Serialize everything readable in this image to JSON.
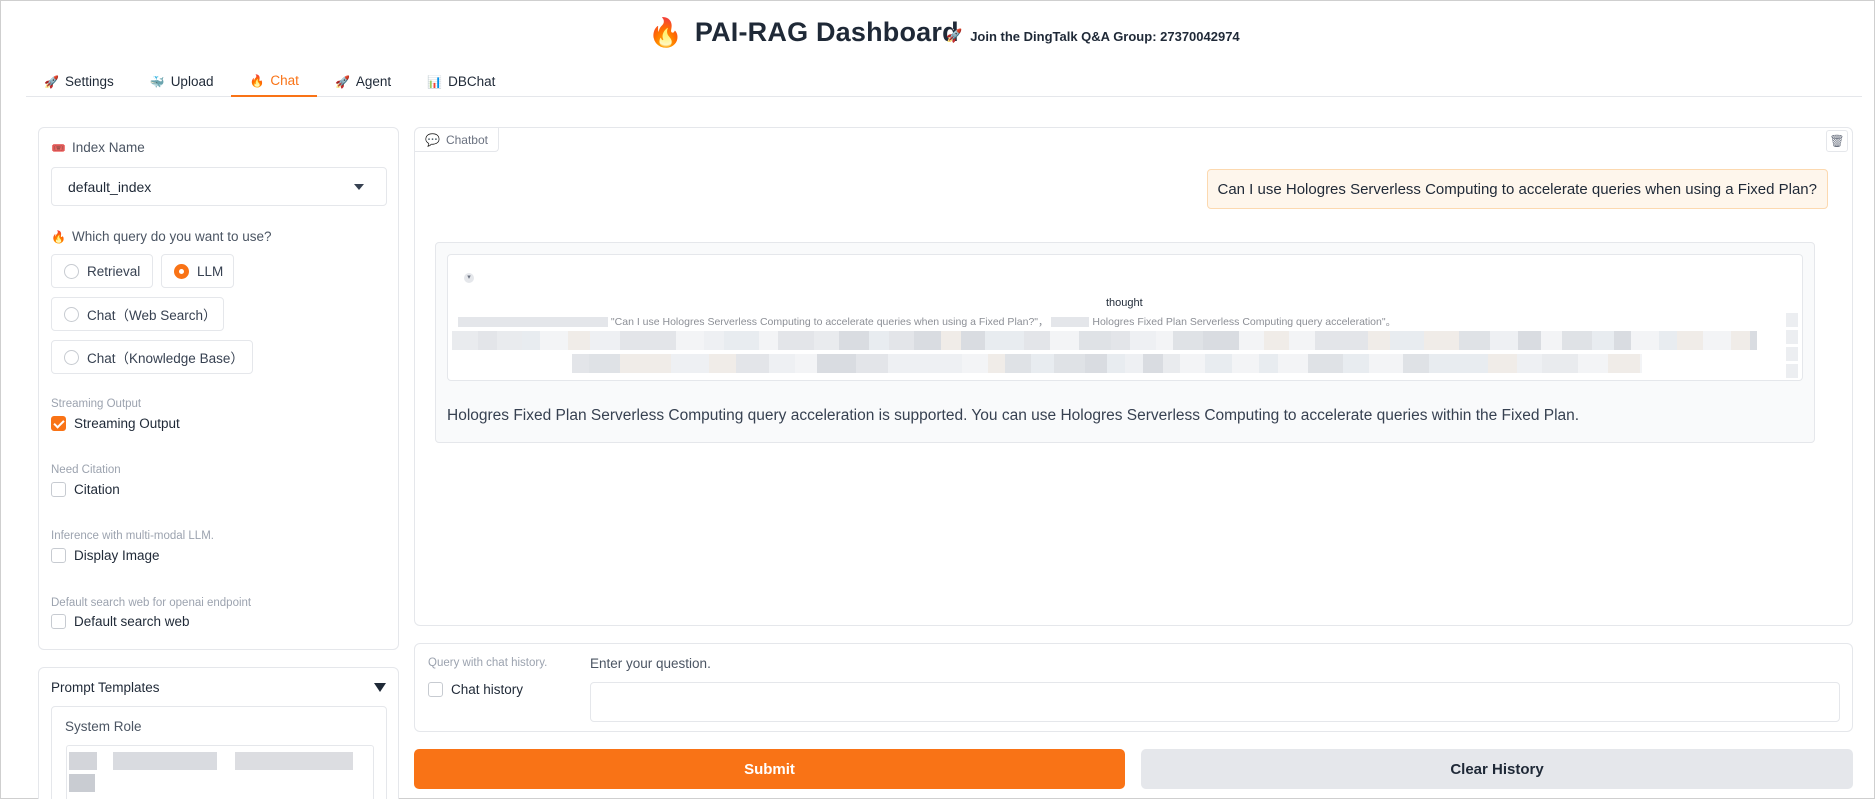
{
  "header": {
    "title": "PAI-RAG Dashboard",
    "title_icon": "flame-icon",
    "group_icon": "rocket-icon",
    "group_text": "Join the DingTalk Q&A Group: 27370042974"
  },
  "tabs": [
    {
      "label": "Settings",
      "icon": "rocket-icon",
      "active": false
    },
    {
      "label": "Upload",
      "icon": "whale-icon",
      "active": false
    },
    {
      "label": "Chat",
      "icon": "flame-icon",
      "active": true
    },
    {
      "label": "Agent",
      "icon": "rocket-icon",
      "active": false
    },
    {
      "label": "DBChat",
      "icon": "bar-chart-icon",
      "active": false
    }
  ],
  "sidebar": {
    "index_label": "Index Name",
    "index_value": "default_index",
    "query_label": "Which query do you want to use?",
    "query_options": [
      {
        "label": "Retrieval",
        "selected": false
      },
      {
        "label": "LLM",
        "selected": true
      },
      {
        "label": "Chat（Web Search）",
        "selected": false
      },
      {
        "label": "Chat（Knowledge Base）",
        "selected": false
      }
    ],
    "streaming_section": "Streaming Output",
    "streaming_label": "Streaming Output",
    "streaming_checked": true,
    "citation_section": "Need Citation",
    "citation_label": "Citation",
    "citation_checked": false,
    "multimodal_section": "Inference with multi-modal LLM.",
    "multimodal_label": "Display Image",
    "multimodal_checked": false,
    "web_section": "Default search web for openai endpoint",
    "web_label": "Default search web",
    "web_checked": false
  },
  "prompt": {
    "title": "Prompt Templates",
    "system_role_label": "System Role"
  },
  "chat": {
    "tag": "Chatbot",
    "user_message": "Can I use Hologres Serverless Computing to accelerate queries when using a Fixed Plan?",
    "thought_label": "thought",
    "thought_question": "\"Can I use Hologres Serverless Computing to accelerate queries when using a Fixed Plan?\"，",
    "thought_tail": "Hologres Fixed Plan Serverless Computing query acceleration\"。",
    "answer": "Hologres Fixed Plan Serverless Computing query acceleration is supported. You can use Hologres Serverless Computing to accelerate queries within the Fixed Plan."
  },
  "query": {
    "history_section": "Query with chat history.",
    "history_label": "Chat history",
    "history_checked": false,
    "question_label": "Enter your question.",
    "question_value": ""
  },
  "buttons": {
    "submit": "Submit",
    "clear": "Clear History"
  },
  "colors": {
    "accent": "#f97316",
    "user_bubble": "#fef6ec"
  }
}
